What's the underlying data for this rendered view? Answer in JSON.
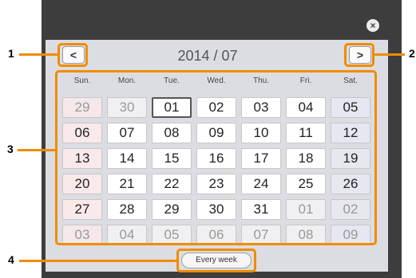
{
  "header": {
    "month_title": "2014 / 07",
    "prev_label": "<",
    "next_label": ">",
    "close_label": "×"
  },
  "weekdays": [
    "Sun.",
    "Mon.",
    "Tue.",
    "Wed.",
    "Thu.",
    "Fri.",
    "Sat."
  ],
  "days": [
    {
      "label": "29",
      "other_month": true
    },
    {
      "label": "30",
      "other_month": true
    },
    {
      "label": "01",
      "other_month": false,
      "selected": true
    },
    {
      "label": "02",
      "other_month": false
    },
    {
      "label": "03",
      "other_month": false
    },
    {
      "label": "04",
      "other_month": false
    },
    {
      "label": "05",
      "other_month": false
    },
    {
      "label": "06",
      "other_month": false
    },
    {
      "label": "07",
      "other_month": false
    },
    {
      "label": "08",
      "other_month": false
    },
    {
      "label": "09",
      "other_month": false
    },
    {
      "label": "10",
      "other_month": false
    },
    {
      "label": "11",
      "other_month": false
    },
    {
      "label": "12",
      "other_month": false
    },
    {
      "label": "13",
      "other_month": false
    },
    {
      "label": "14",
      "other_month": false
    },
    {
      "label": "15",
      "other_month": false
    },
    {
      "label": "16",
      "other_month": false
    },
    {
      "label": "17",
      "other_month": false
    },
    {
      "label": "18",
      "other_month": false
    },
    {
      "label": "19",
      "other_month": false
    },
    {
      "label": "20",
      "other_month": false
    },
    {
      "label": "21",
      "other_month": false
    },
    {
      "label": "22",
      "other_month": false
    },
    {
      "label": "23",
      "other_month": false
    },
    {
      "label": "24",
      "other_month": false
    },
    {
      "label": "25",
      "other_month": false
    },
    {
      "label": "26",
      "other_month": false
    },
    {
      "label": "27",
      "other_month": false
    },
    {
      "label": "28",
      "other_month": false
    },
    {
      "label": "29",
      "other_month": false
    },
    {
      "label": "30",
      "other_month": false
    },
    {
      "label": "31",
      "other_month": false
    },
    {
      "label": "01",
      "other_month": true
    },
    {
      "label": "02",
      "other_month": true
    },
    {
      "label": "03",
      "other_month": true
    },
    {
      "label": "04",
      "other_month": true
    },
    {
      "label": "05",
      "other_month": true
    },
    {
      "label": "06",
      "other_month": true
    },
    {
      "label": "07",
      "other_month": true
    },
    {
      "label": "08",
      "other_month": true
    },
    {
      "label": "09",
      "other_month": true
    }
  ],
  "footer": {
    "every_week_label": "Every week"
  },
  "callouts": [
    "1",
    "2",
    "3",
    "4"
  ],
  "colors": {
    "highlight": "#f08c00",
    "panel": "#3d3d3d",
    "inner": "#dcdde2",
    "sunday_bg": "#fae9ea",
    "saturday_bg": "#e6e7f0"
  }
}
